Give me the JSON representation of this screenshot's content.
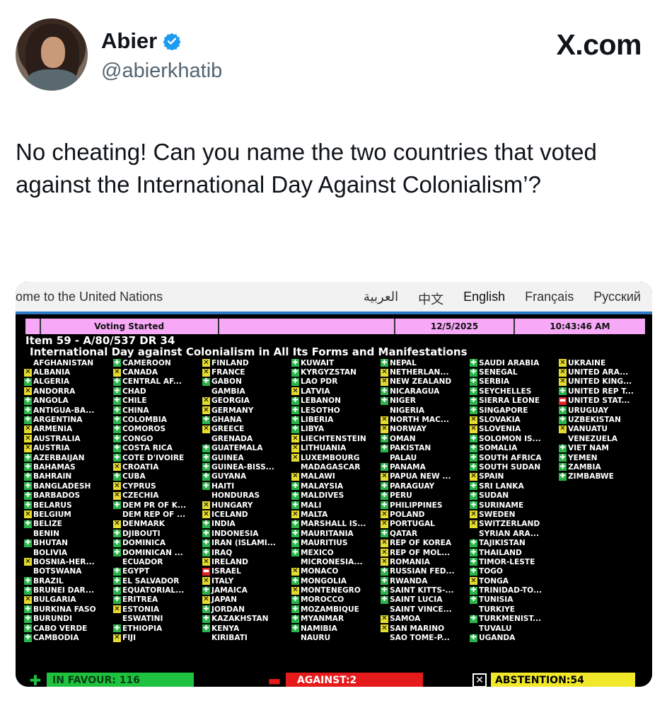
{
  "post": {
    "author_name": "Abier",
    "handle": "@abierkhatib",
    "site": "X.com",
    "text": "No cheating! Can you name the two countries that voted against the International Day Against Colonialism’?"
  },
  "screenshot": {
    "topbar": {
      "welcome": "ome to the United Nations",
      "languages": [
        "العربية",
        "中文",
        "English",
        "Français",
        "Русский"
      ]
    },
    "board": {
      "status": "Voting Started",
      "date": "12/5/2025",
      "time": "10:43:46 AM",
      "item": "Item 59 - A/80/537 DR 34",
      "title": "International Day against Colonialism in All Its Forms and Manifestations",
      "columns": [
        [
          [
            "",
            "AFGHANISTAN"
          ],
          [
            "A",
            "ALBANIA"
          ],
          [
            "Y",
            "ALGERIA"
          ],
          [
            "A",
            "ANDORRA"
          ],
          [
            "Y",
            "ANGOLA"
          ],
          [
            "Y",
            "ANTIGUA-BA..."
          ],
          [
            "Y",
            "ARGENTINA"
          ],
          [
            "A",
            "ARMENIA"
          ],
          [
            "A",
            "AUSTRALIA"
          ],
          [
            "A",
            "AUSTRIA"
          ],
          [
            "Y",
            "AZERBAIJAN"
          ],
          [
            "Y",
            "BAHAMAS"
          ],
          [
            "Y",
            "BAHRAIN"
          ],
          [
            "Y",
            "BANGLADESH"
          ],
          [
            "Y",
            "BARBADOS"
          ],
          [
            "Y",
            "BELARUS"
          ],
          [
            "A",
            "BELGIUM"
          ],
          [
            "Y",
            "BELIZE"
          ],
          [
            "",
            "BENIN"
          ],
          [
            "Y",
            "BHUTAN"
          ],
          [
            "",
            "BOLIVIA"
          ],
          [
            "A",
            "BOSNIA-HER..."
          ],
          [
            "",
            "BOTSWANA"
          ],
          [
            "Y",
            "BRAZIL"
          ],
          [
            "Y",
            "BRUNEI DAR..."
          ],
          [
            "A",
            "BULGARIA"
          ],
          [
            "Y",
            "BURKINA FASO"
          ],
          [
            "Y",
            "BURUNDI"
          ],
          [
            "Y",
            "CABO VERDE"
          ],
          [
            "Y",
            "CAMBODIA"
          ]
        ],
        [
          [
            "Y",
            "CAMEROON"
          ],
          [
            "A",
            "CANADA"
          ],
          [
            "Y",
            "CENTRAL AF..."
          ],
          [
            "Y",
            "CHAD"
          ],
          [
            "Y",
            "CHILE"
          ],
          [
            "Y",
            "CHINA"
          ],
          [
            "Y",
            "COLOMBIA"
          ],
          [
            "Y",
            "COMOROS"
          ],
          [
            "Y",
            "CONGO"
          ],
          [
            "Y",
            "COSTA RICA"
          ],
          [
            "Y",
            "COTE D'IVOIRE"
          ],
          [
            "A",
            "CROATIA"
          ],
          [
            "Y",
            "CUBA"
          ],
          [
            "A",
            "CYPRUS"
          ],
          [
            "A",
            "CZECHIA"
          ],
          [
            "Y",
            "DEM PR OF K..."
          ],
          [
            "",
            "DEM REP OF ..."
          ],
          [
            "A",
            "DENMARK"
          ],
          [
            "Y",
            "DJIBOUTI"
          ],
          [
            "Y",
            "DOMINICA"
          ],
          [
            "Y",
            "DOMINICAN ..."
          ],
          [
            "",
            "ECUADOR"
          ],
          [
            "Y",
            "EGYPT"
          ],
          [
            "Y",
            "EL SALVADOR"
          ],
          [
            "Y",
            "EQUATORIAL..."
          ],
          [
            "Y",
            "ERITREA"
          ],
          [
            "A",
            "ESTONIA"
          ],
          [
            "",
            "ESWATINI"
          ],
          [
            "Y",
            "ETHIOPIA"
          ],
          [
            "A",
            "FIJI"
          ]
        ],
        [
          [
            "A",
            "FINLAND"
          ],
          [
            "A",
            "FRANCE"
          ],
          [
            "Y",
            "GABON"
          ],
          [
            "",
            "GAMBIA"
          ],
          [
            "A",
            "GEORGIA"
          ],
          [
            "A",
            "GERMANY"
          ],
          [
            "Y",
            "GHANA"
          ],
          [
            "A",
            "GREECE"
          ],
          [
            "",
            "GRENADA"
          ],
          [
            "Y",
            "GUATEMALA"
          ],
          [
            "Y",
            "GUINEA"
          ],
          [
            "Y",
            "GUINEA-BISS..."
          ],
          [
            "Y",
            "GUYANA"
          ],
          [
            "Y",
            "HAITI"
          ],
          [
            "",
            "HONDURAS"
          ],
          [
            "A",
            "HUNGARY"
          ],
          [
            "A",
            "ICELAND"
          ],
          [
            "Y",
            "INDIA"
          ],
          [
            "Y",
            "INDONESIA"
          ],
          [
            "Y",
            "IRAN (ISLAMI..."
          ],
          [
            "Y",
            "IRAQ"
          ],
          [
            "A",
            "IRELAND"
          ],
          [
            "N",
            "ISRAEL"
          ],
          [
            "A",
            "ITALY"
          ],
          [
            "Y",
            "JAMAICA"
          ],
          [
            "A",
            "JAPAN"
          ],
          [
            "Y",
            "JORDAN"
          ],
          [
            "Y",
            "KAZAKHSTAN"
          ],
          [
            "Y",
            "KENYA"
          ],
          [
            "",
            "KIRIBATI"
          ]
        ],
        [
          [
            "Y",
            "KUWAIT"
          ],
          [
            "Y",
            "KYRGYZSTAN"
          ],
          [
            "Y",
            "LAO PDR"
          ],
          [
            "A",
            "LATVIA"
          ],
          [
            "Y",
            "LEBANON"
          ],
          [
            "Y",
            "LESOTHO"
          ],
          [
            "Y",
            "LIBERIA"
          ],
          [
            "Y",
            "LIBYA"
          ],
          [
            "A",
            "LIECHTENSTEIN"
          ],
          [
            "A",
            "LITHUANIA"
          ],
          [
            "A",
            "LUXEMBOURG"
          ],
          [
            "",
            "MADAGASCAR"
          ],
          [
            "A",
            "MALAWI"
          ],
          [
            "Y",
            "MALAYSIA"
          ],
          [
            "Y",
            "MALDIVES"
          ],
          [
            "Y",
            "MALI"
          ],
          [
            "A",
            "MALTA"
          ],
          [
            "Y",
            "MARSHALL IS..."
          ],
          [
            "Y",
            "MAURITANIA"
          ],
          [
            "Y",
            "MAURITIUS"
          ],
          [
            "Y",
            "MEXICO"
          ],
          [
            "",
            "MICRONESIA..."
          ],
          [
            "A",
            "MONACO"
          ],
          [
            "Y",
            "MONGOLIA"
          ],
          [
            "A",
            "MONTENEGRO"
          ],
          [
            "Y",
            "MOROCCO"
          ],
          [
            "Y",
            "MOZAMBIQUE"
          ],
          [
            "Y",
            "MYANMAR"
          ],
          [
            "Y",
            "NAMIBIA"
          ],
          [
            "",
            "NAURU"
          ]
        ],
        [
          [
            "Y",
            "NEPAL"
          ],
          [
            "A",
            "NETHERLAN..."
          ],
          [
            "A",
            "NEW ZEALAND"
          ],
          [
            "Y",
            "NICARAGUA"
          ],
          [
            "Y",
            "NIGER"
          ],
          [
            "",
            "NIGERIA"
          ],
          [
            "A",
            "NORTH MAC..."
          ],
          [
            "A",
            "NORWAY"
          ],
          [
            "Y",
            "OMAN"
          ],
          [
            "Y",
            "PAKISTAN"
          ],
          [
            "",
            "PALAU"
          ],
          [
            "Y",
            "PANAMA"
          ],
          [
            "A",
            "PAPUA NEW ..."
          ],
          [
            "Y",
            "PARAGUAY"
          ],
          [
            "Y",
            "PERU"
          ],
          [
            "Y",
            "PHILIPPINES"
          ],
          [
            "A",
            "POLAND"
          ],
          [
            "A",
            "PORTUGAL"
          ],
          [
            "Y",
            "QATAR"
          ],
          [
            "A",
            "REP OF KOREA"
          ],
          [
            "A",
            "REP OF MOL..."
          ],
          [
            "A",
            "ROMANIA"
          ],
          [
            "Y",
            "RUSSIAN FED..."
          ],
          [
            "Y",
            "RWANDA"
          ],
          [
            "Y",
            "SAINT KITTS-..."
          ],
          [
            "Y",
            "SAINT LUCIA"
          ],
          [
            "",
            "SAINT VINCE..."
          ],
          [
            "A",
            "SAMOA"
          ],
          [
            "A",
            "SAN MARINO"
          ],
          [
            "",
            "SAO TOME-P..."
          ]
        ],
        [
          [
            "Y",
            "SAUDI ARABIA"
          ],
          [
            "Y",
            "SENEGAL"
          ],
          [
            "Y",
            "SERBIA"
          ],
          [
            "Y",
            "SEYCHELLES"
          ],
          [
            "Y",
            "SIERRA LEONE"
          ],
          [
            "Y",
            "SINGAPORE"
          ],
          [
            "A",
            "SLOVAKIA"
          ],
          [
            "A",
            "SLOVENIA"
          ],
          [
            "Y",
            "SOLOMON IS..."
          ],
          [
            "Y",
            "SOMALIA"
          ],
          [
            "Y",
            "SOUTH AFRICA"
          ],
          [
            "Y",
            "SOUTH SUDAN"
          ],
          [
            "A",
            "SPAIN"
          ],
          [
            "Y",
            "SRI LANKA"
          ],
          [
            "Y",
            "SUDAN"
          ],
          [
            "Y",
            "SURINAME"
          ],
          [
            "A",
            "SWEDEN"
          ],
          [
            "A",
            "SWITZERLAND"
          ],
          [
            "",
            "SYRIAN ARA..."
          ],
          [
            "Y",
            "TAJIKISTAN"
          ],
          [
            "Y",
            "THAILAND"
          ],
          [
            "Y",
            "TIMOR-LESTE"
          ],
          [
            "Y",
            "TOGO"
          ],
          [
            "A",
            "TONGA"
          ],
          [
            "Y",
            "TRINIDAD-TO..."
          ],
          [
            "Y",
            "TUNISIA"
          ],
          [
            "",
            "TURKIYE"
          ],
          [
            "Y",
            "TURKMENIST..."
          ],
          [
            "",
            "TUVALU"
          ],
          [
            "Y",
            "UGANDA"
          ]
        ],
        [
          [
            "A",
            "UKRAINE"
          ],
          [
            "A",
            "UNITED ARA..."
          ],
          [
            "A",
            "UNITED KING..."
          ],
          [
            "Y",
            "UNITED REP T..."
          ],
          [
            "N",
            "UNITED STAT..."
          ],
          [
            "Y",
            "URUGUAY"
          ],
          [
            "Y",
            "UZBEKISTAN"
          ],
          [
            "A",
            "VANUATU"
          ],
          [
            "",
            "VENEZUELA"
          ],
          [
            "Y",
            "VIET NAM"
          ],
          [
            "Y",
            "YEMEN"
          ],
          [
            "Y",
            "ZAMBIA"
          ],
          [
            "Y",
            "ZIMBABWE"
          ]
        ]
      ],
      "totals": {
        "favour": "IN FAVOUR: 116",
        "against": "AGAINST:2",
        "abstention": "ABSTENTION:54"
      }
    }
  }
}
